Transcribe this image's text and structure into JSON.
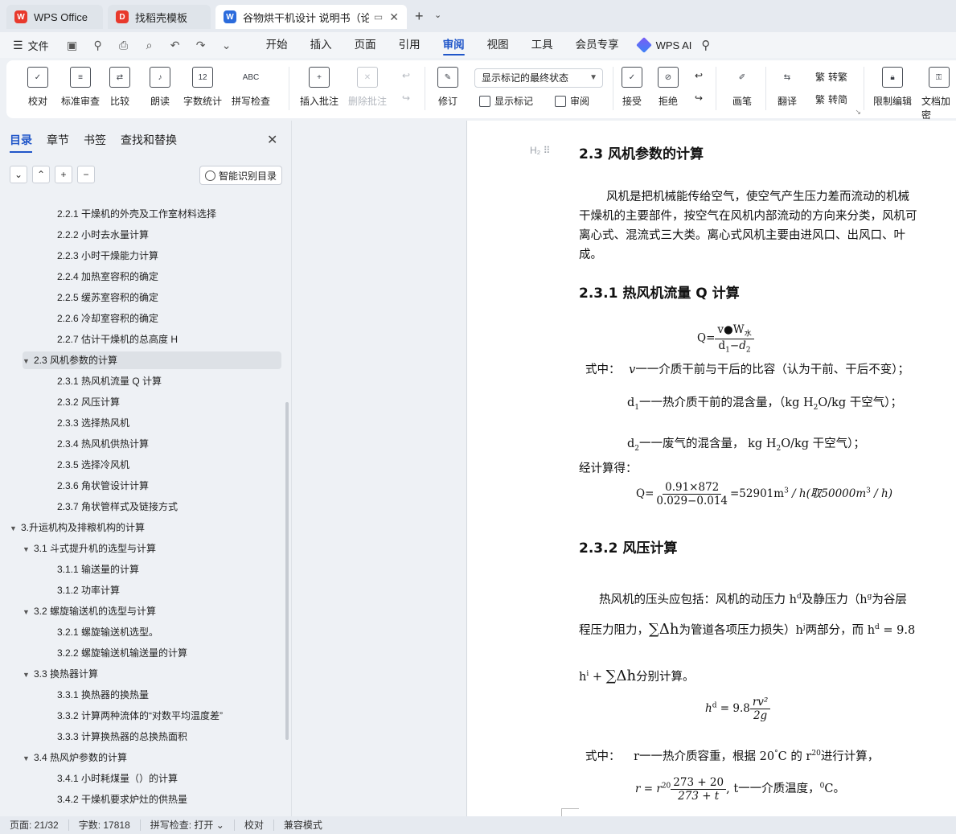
{
  "tabs": [
    {
      "label": "WPS Office",
      "icon": "wps-logo-icon"
    },
    {
      "label": "找稻壳模板",
      "icon": "docer-icon"
    },
    {
      "label": "谷物烘干机设计 说明书（论文",
      "icon": "word-doc-icon"
    }
  ],
  "menubar": {
    "file_label": "文件",
    "items": [
      "开始",
      "插入",
      "页面",
      "引用",
      "审阅",
      "视图",
      "工具",
      "会员专享"
    ],
    "active": "审阅",
    "ai_label": "WPS AI"
  },
  "ribbon": {
    "buttons": [
      {
        "label": "校对",
        "icon": "proofread-icon"
      },
      {
        "label": "标准审查",
        "icon": "standard-review-icon"
      },
      {
        "label": "比较",
        "icon": "compare-icon"
      },
      {
        "label": "朗读",
        "icon": "read-aloud-icon"
      },
      {
        "label": "字数统计",
        "icon": "word-count-icon",
        "glyph": "12"
      },
      {
        "label": "拼写检查",
        "icon": "spell-check-icon",
        "glyph": "ABC"
      },
      {
        "label": "插入批注",
        "icon": "insert-comment-icon"
      },
      {
        "label": "删除批注",
        "icon": "delete-comment-icon"
      },
      {
        "label": "修订",
        "icon": "revise-icon"
      },
      {
        "label": "接受",
        "icon": "accept-icon"
      },
      {
        "label": "拒绝",
        "icon": "reject-icon"
      },
      {
        "label": "画笔",
        "icon": "pen-icon"
      },
      {
        "label": "翻译",
        "icon": "translate-icon"
      },
      {
        "label": "限制编辑",
        "icon": "restrict-edit-icon"
      },
      {
        "label": "文档加密",
        "icon": "encrypt-icon"
      }
    ],
    "markup_select": "显示标记的最终状态",
    "show_markup": "显示标记",
    "review_pane": "审阅",
    "to_trad": "繁转简",
    "trad": "转繁",
    "simp": "转简"
  },
  "nav": {
    "tabs": [
      "目录",
      "章节",
      "书签",
      "查找和替换"
    ],
    "active_tab": "目录",
    "smart_button": "智能识别目录",
    "toc": [
      {
        "text": "2.2.1  干燥机的外壳及工作室材料选择",
        "level": 3
      },
      {
        "text": "2.2.2  小时去水量计算",
        "level": 3
      },
      {
        "text": "2.2.3  小时干燥能力计算",
        "level": 3
      },
      {
        "text": "2.2.4  加热室容积的确定",
        "level": 3
      },
      {
        "text": "2.2.5  缓苏室容积的确定",
        "level": 3
      },
      {
        "text": "2.2.6  冷却室容积的确定",
        "level": 3
      },
      {
        "text": "2.2.7 估计干燥机的总高度 H",
        "level": 3
      },
      {
        "text": "2.3 风机参数的计算",
        "level": 2,
        "expanded": true,
        "selected": true
      },
      {
        "text": "2.3.1 热风机流量 Q 计算",
        "level": 3
      },
      {
        "text": "2.3.2  风压计算",
        "level": 3
      },
      {
        "text": "2.3.3    选择热风机",
        "level": 3
      },
      {
        "text": "2.3.4  热风机供热计算",
        "level": 3
      },
      {
        "text": "2.3.5  选择冷风机",
        "level": 3
      },
      {
        "text": "2.3.6  角状管设计计算",
        "level": 3
      },
      {
        "text": "2.3.7 角状管样式及链接方式",
        "level": 3
      },
      {
        "text": "3.升运机构及排粮机构的计算",
        "level": 1,
        "expanded": true
      },
      {
        "text": "3.1 斗式提升机的选型与计算",
        "level": 2,
        "expanded": true
      },
      {
        "text": "3.1.1 输送量的计算",
        "level": 3
      },
      {
        "text": "3.1.2 功率计算",
        "level": 3
      },
      {
        "text": "3.2 螺旋输送机的选型与计算",
        "level": 2,
        "expanded": true
      },
      {
        "text": "3.2.1 螺旋输送机选型。",
        "level": 3
      },
      {
        "text": "3.2.2 螺旋输送机输送量的计算",
        "level": 3
      },
      {
        "text": "3.3 换热器计算",
        "level": 2,
        "expanded": true
      },
      {
        "text": "3.3.1  换热器的换热量",
        "level": 3
      },
      {
        "text": "3.3.2 计算两种流体的“对数平均温度差”",
        "level": 3
      },
      {
        "text": "3.3.3 计算换热器的总换热面积",
        "level": 3
      },
      {
        "text": "3.4 热风炉参数的计算",
        "level": 2,
        "expanded": true
      },
      {
        "text": "3.4.1 小时耗煤量（）的计算",
        "level": 3
      },
      {
        "text": "3.4.2 干燥机要求炉灶的供热量",
        "level": 3
      }
    ]
  },
  "doc": {
    "heading_marker": "H₂",
    "h_2_3": "2.3 风机参数的计算",
    "p1_line1": "风机是把机械能传给空气，使空气产生压力差而流动的机械",
    "p1_line2": "干燥机的主要部件，按空气在风机内部流动的方向来分类，风机可",
    "p1_line3": "离心式、混流式三大类。离心式风机主要由进风口、出风口、叶",
    "p1_line4": "成。",
    "h_2_3_1": "2.3.1 热风机流量 Q 计算",
    "f1_lhs": "Q=",
    "f1_num": "v●W",
    "f1_num_sub": "水",
    "f1_den": "d",
    "f1_den_sub1": "1",
    "f1_den_mid": "−d",
    "f1_den_sub2": "2",
    "where_label": "式中：",
    "where_v_sym": "v",
    "where_v": "一一介质干前与干后的比容（认为干前、干后不变）；",
    "d1_sym": "d",
    "d1_sub": "1",
    "d1_text": "一一热介质干前的混含量，（kg H",
    "d1_unit_sub": "2",
    "d1_unit_end": "O/kg  干空气）；",
    "d2_sym": "d",
    "d2_sub": "2",
    "d2_text": "一一废气的混含量，  kg H",
    "d2_unit_sub": "2",
    "d2_unit_end": "O/kg  干空气）；",
    "calc_label": "经计算得：",
    "f2_lhs": "Q=",
    "f2_num": "0.91×872",
    "f2_den": "0.029−0.014",
    "f2_rhs_a": "=52901m",
    "f2_rhs_sup": "3",
    "f2_rhs_b": " / h(取50000m",
    "f2_rhs_sup2": "3",
    "f2_rhs_c": " / h)",
    "h_2_3_2": "2.3.2  风压计算",
    "p2_line1": "热风机的压头应包括：风机的动压力 h",
    "p2_sup_d": "d",
    "p2_line1b": "及静压力（h",
    "p2_sup_g": "g",
    "p2_line1c": "为谷层",
    "p2_line2a": "程压力阻力，",
    "p2_sum": "∑Δh",
    "p2_line2b": "为管道各项压力损失）h",
    "p2_sup_j": "j",
    "p2_line2c": "两部分，而 h",
    "p2_sup_d2": "d",
    "p2_line2d": " = 9.8",
    "p3_a": "h",
    "p3_sup_i": "i",
    "p3_b": " + ",
    "p3_sum": "∑Δh",
    "p3_c": "分别计算。",
    "f3_lhs": "h",
    "f3_lhs_sup": "d",
    "f3_mid": " = 9.8",
    "f3_num": "rv²",
    "f3_den": "2g",
    "where2_label": "式中：",
    "r_text_a": "r一一热介质容重，根据 20",
    "r_deg": "°",
    "r_text_b": "C 的 r",
    "r_sup": "20",
    "r_text_c": "进行计算，",
    "f4_lhs": "r = r",
    "f4_sup": "20",
    "f4_num": "273 + 20",
    "f4_den": "273 + t",
    "f4_tail_a": ",     t一一介质温度，",
    "f4_tail_sup": "0",
    "f4_tail_b": "C。"
  },
  "status": {
    "page": "页面: 21/32",
    "words": "字数: 17818",
    "spell": "拼写检查: 打开",
    "proof": "校对",
    "compat": "兼容模式"
  }
}
